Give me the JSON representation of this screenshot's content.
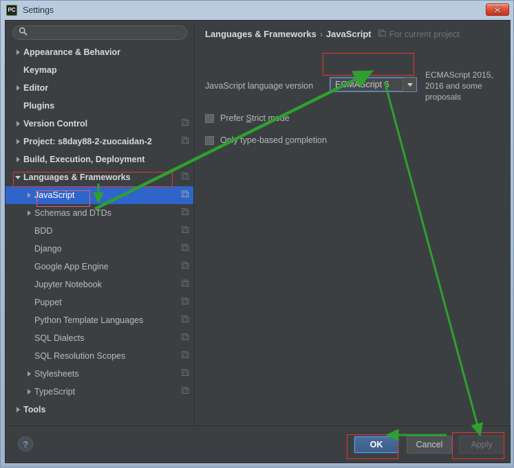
{
  "window": {
    "title": "Settings",
    "app_icon": "pycharm-pc-icon",
    "logo_text": "PC",
    "close_label": "x"
  },
  "search": {
    "value": "",
    "placeholder": "",
    "icon": "search-icon"
  },
  "sidebar": {
    "items": [
      {
        "label": "Appearance & Behavior",
        "expander": "right",
        "bold": true,
        "indent": 10,
        "module_icon": false,
        "selected": false
      },
      {
        "label": "Keymap",
        "expander": "none",
        "bold": true,
        "indent": 10,
        "module_icon": false,
        "selected": false
      },
      {
        "label": "Editor",
        "expander": "right",
        "bold": true,
        "indent": 10,
        "module_icon": false,
        "selected": false
      },
      {
        "label": "Plugins",
        "expander": "none",
        "bold": true,
        "indent": 10,
        "module_icon": false,
        "selected": false
      },
      {
        "label": "Version Control",
        "expander": "right",
        "bold": true,
        "indent": 10,
        "module_icon": true,
        "selected": false
      },
      {
        "label": "Project: s8day88-2-zuocaidan-2",
        "expander": "right",
        "bold": true,
        "indent": 10,
        "module_icon": true,
        "selected": false
      },
      {
        "label": "Build, Execution, Deployment",
        "expander": "right",
        "bold": true,
        "indent": 10,
        "module_icon": false,
        "selected": false
      },
      {
        "label": "Languages & Frameworks",
        "expander": "down",
        "bold": true,
        "indent": 10,
        "module_icon": true,
        "selected": false
      },
      {
        "label": "JavaScript",
        "expander": "right",
        "bold": false,
        "indent": 26,
        "module_icon": true,
        "selected": true
      },
      {
        "label": "Schemas and DTDs",
        "expander": "right",
        "bold": false,
        "indent": 26,
        "module_icon": true,
        "selected": false
      },
      {
        "label": "BDD",
        "expander": "none",
        "bold": false,
        "indent": 26,
        "module_icon": true,
        "selected": false
      },
      {
        "label": "Django",
        "expander": "none",
        "bold": false,
        "indent": 26,
        "module_icon": true,
        "selected": false
      },
      {
        "label": "Google App Engine",
        "expander": "none",
        "bold": false,
        "indent": 26,
        "module_icon": true,
        "selected": false
      },
      {
        "label": "Jupyter Notebook",
        "expander": "none",
        "bold": false,
        "indent": 26,
        "module_icon": true,
        "selected": false
      },
      {
        "label": "Puppet",
        "expander": "none",
        "bold": false,
        "indent": 26,
        "module_icon": true,
        "selected": false
      },
      {
        "label": "Python Template Languages",
        "expander": "none",
        "bold": false,
        "indent": 26,
        "module_icon": true,
        "selected": false
      },
      {
        "label": "SQL Dialects",
        "expander": "none",
        "bold": false,
        "indent": 26,
        "module_icon": true,
        "selected": false
      },
      {
        "label": "SQL Resolution Scopes",
        "expander": "none",
        "bold": false,
        "indent": 26,
        "module_icon": true,
        "selected": false
      },
      {
        "label": "Stylesheets",
        "expander": "right",
        "bold": false,
        "indent": 26,
        "module_icon": true,
        "selected": false
      },
      {
        "label": "TypeScript",
        "expander": "right",
        "bold": false,
        "indent": 26,
        "module_icon": true,
        "selected": false
      },
      {
        "label": "Tools",
        "expander": "right",
        "bold": true,
        "indent": 10,
        "module_icon": false,
        "selected": false
      }
    ]
  },
  "content": {
    "breadcrumb": {
      "root": "Languages & Frameworks",
      "separator": "›",
      "leaf": "JavaScript",
      "scope_icon": "module-icon",
      "scope_text": "For current project"
    },
    "language_version": {
      "label": "JavaScript language version",
      "value": "ECMAScript 6",
      "dropdown_icon": "chevron-down-icon",
      "hint": "ECMAScript 2015, 2016 and some proposals"
    },
    "checkboxes": [
      {
        "label_before": "Prefer ",
        "mnemonic": "S",
        "label_after": "trict mode",
        "checked": false
      },
      {
        "label_before": "Only type-based ",
        "mnemonic": "c",
        "label_after": "ompletion",
        "checked": false
      }
    ]
  },
  "footer": {
    "help_icon": "help-question-icon",
    "help_label": "?",
    "buttons": [
      {
        "label": "OK",
        "state": "default"
      },
      {
        "label": "Cancel",
        "state": "normal"
      },
      {
        "label": "Apply",
        "state": "disabled"
      }
    ]
  },
  "annotations": {
    "highlight_color": "#e8352e",
    "arrow_color": "#2fa02f",
    "boxes": [
      {
        "name": "languages-frameworks-highlight"
      },
      {
        "name": "javascript-node-highlight"
      },
      {
        "name": "ecmascript-combo-highlight"
      },
      {
        "name": "ok-button-highlight"
      },
      {
        "name": "apply-button-highlight"
      }
    ],
    "arrows": [
      {
        "name": "arrow-to-javascript-node"
      },
      {
        "name": "arrow-to-ecmascript-combo"
      },
      {
        "name": "arrow-to-apply-button"
      },
      {
        "name": "arrow-to-ok-button"
      }
    ]
  }
}
